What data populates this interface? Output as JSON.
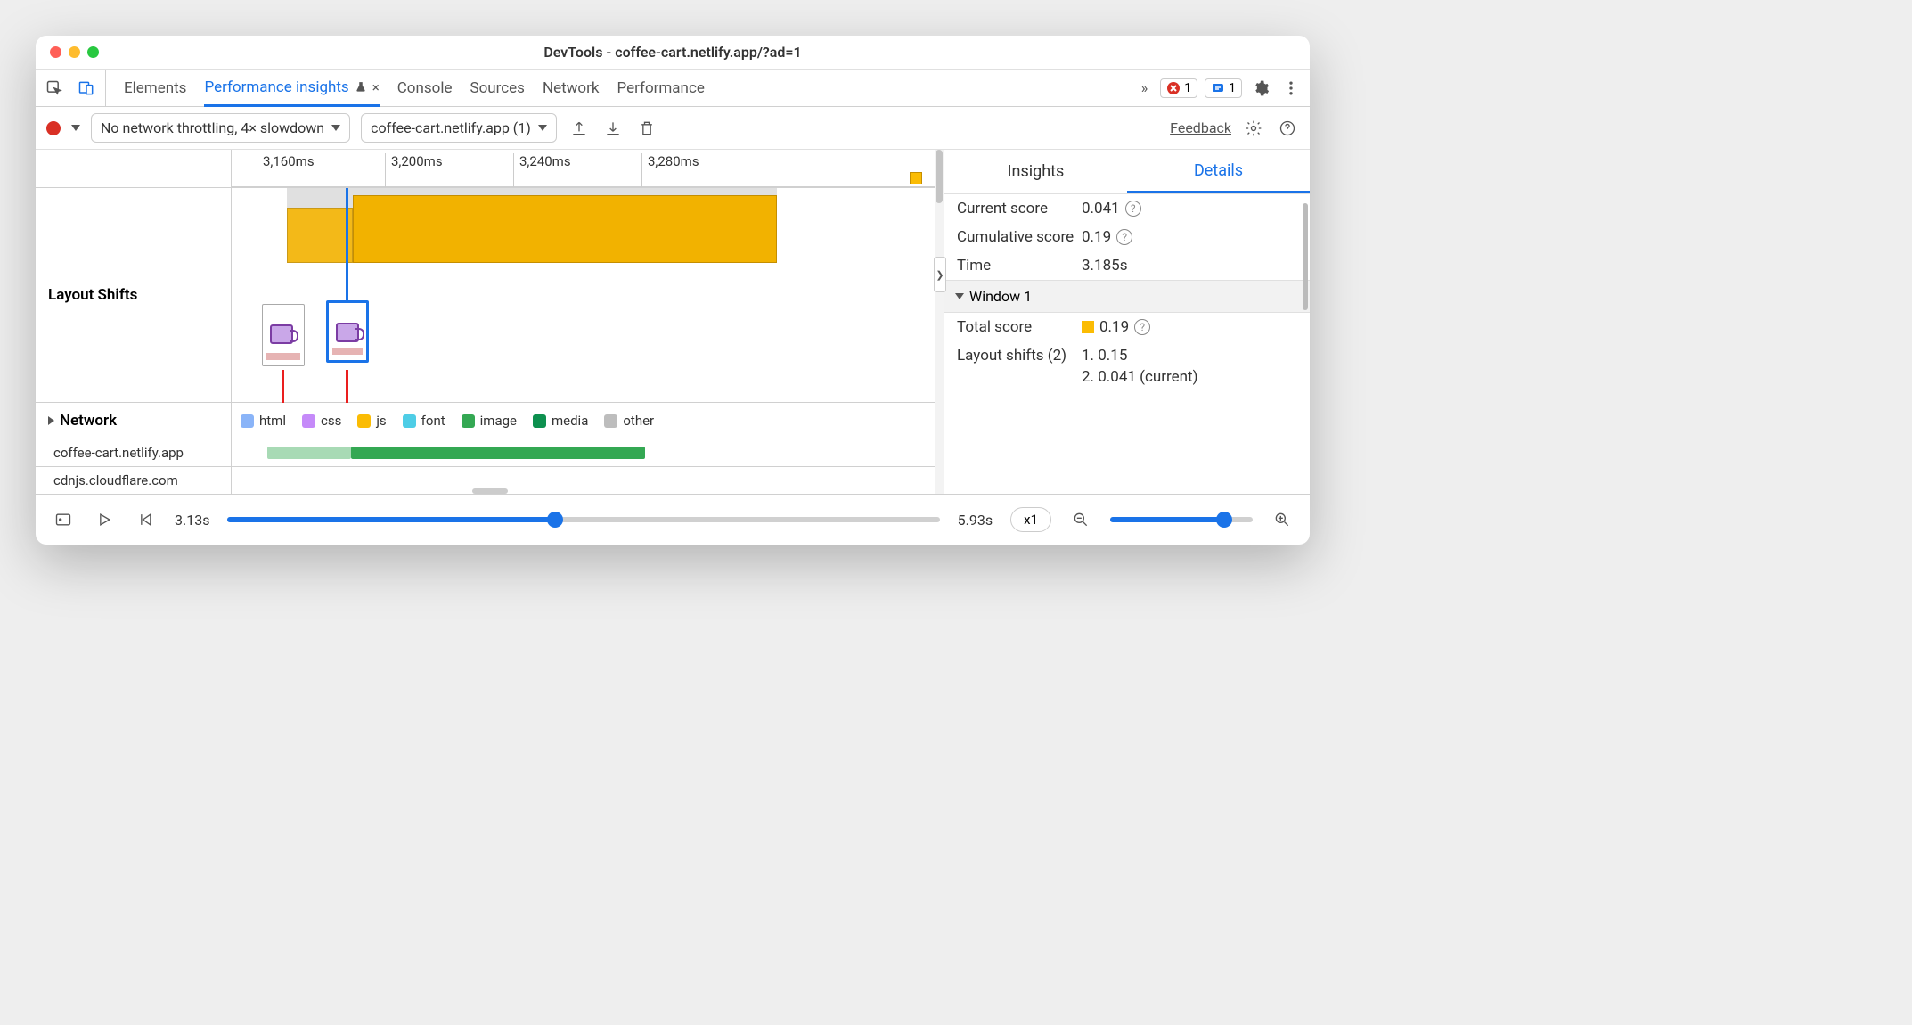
{
  "colors": {
    "accent": "#1a73e8",
    "error": "#d93025",
    "warn": "#fbbc04"
  },
  "titlebar": {
    "title": "DevTools - coffee-cart.netlify.app/?ad=1"
  },
  "tabs": {
    "items": [
      "Elements",
      "Performance insights",
      "Console",
      "Sources",
      "Network",
      "Performance"
    ],
    "active": "Performance insights",
    "error_count": "1",
    "msg_count": "1"
  },
  "toolbar": {
    "throttle": "No network throttling, 4× slowdown",
    "page": "coffee-cart.netlify.app (1)",
    "feedback": "Feedback"
  },
  "ruler": {
    "ticks": [
      "3,160ms",
      "3,200ms",
      "3,240ms",
      "3,280ms"
    ]
  },
  "sections": {
    "layout_shifts": "Layout Shifts",
    "network": "Network",
    "hosts": [
      "coffee-cart.netlify.app",
      "cdnjs.cloudflare.com"
    ]
  },
  "legend": [
    "html",
    "css",
    "js",
    "font",
    "image",
    "media",
    "other"
  ],
  "details": {
    "tab_insights": "Insights",
    "tab_details": "Details",
    "current_score": {
      "label": "Current score",
      "value": "0.041"
    },
    "cumulative_score": {
      "label": "Cumulative score",
      "value": "0.19"
    },
    "time": {
      "label": "Time",
      "value": "3.185s"
    },
    "window_label": "Window 1",
    "total_score": {
      "label": "Total score",
      "value": "0.19"
    },
    "layout_shifts": {
      "label": "Layout shifts (2)",
      "items": [
        "1. 0.15",
        "2. 0.041 (current)"
      ]
    }
  },
  "footer": {
    "start": "3.13s",
    "end": "5.93s",
    "speed": "x1"
  }
}
